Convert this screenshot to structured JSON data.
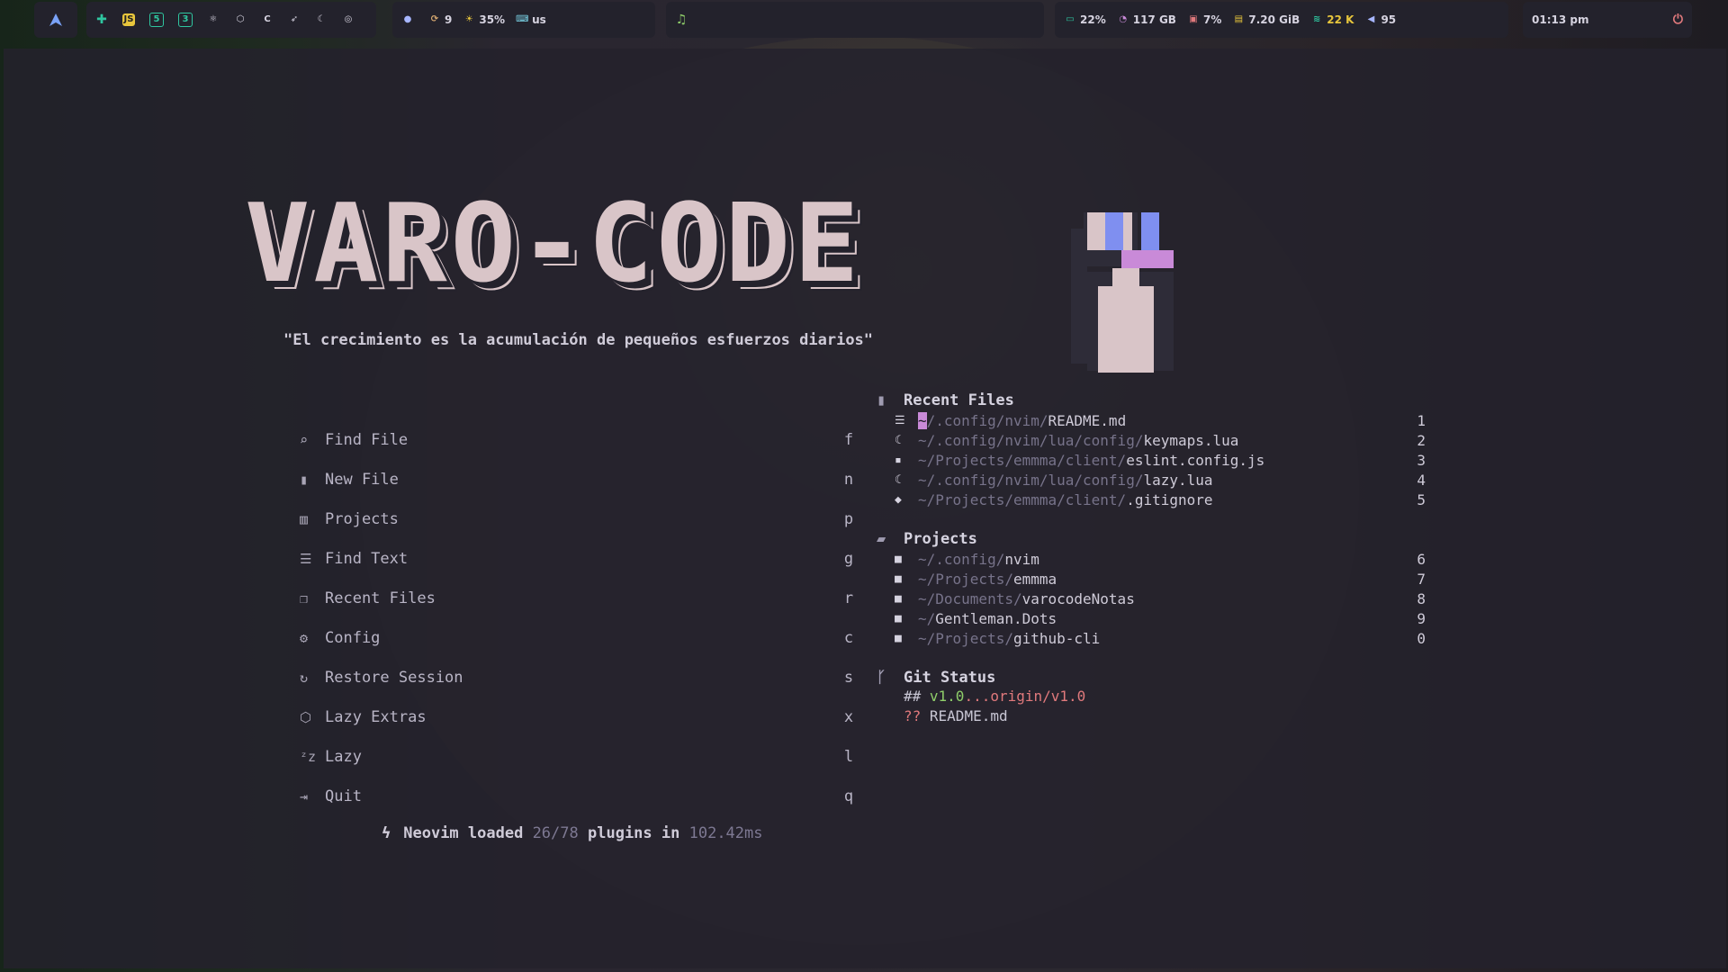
{
  "topbar": {
    "launcher_icon": "arch-icon",
    "workspace_icons": [
      "plus-icon",
      "js-icon",
      "html5-icon",
      "css3-icon",
      "react-icon",
      "nodejs-icon",
      "c-icon",
      "rocket-icon",
      "lua-icon",
      "github-icon"
    ],
    "indicators": {
      "updates": "9",
      "brightness": "35%",
      "keyboard": "us"
    },
    "music_icon": "music-note-icon",
    "stats": {
      "battery": "22%",
      "disk": "117 GB",
      "cpu": "7%",
      "ram": "7.20 GiB",
      "network": "22 K",
      "volume": "95"
    },
    "clock": "01:13 pm"
  },
  "dashboard": {
    "logo": "VARO-CODE",
    "tagline": "\"El crecimiento es la acumulación de pequeños esfuerzos diarios\"",
    "menu": [
      {
        "icon": "search-icon",
        "label": "Find File",
        "key": "f"
      },
      {
        "icon": "file-icon",
        "label": "New File",
        "key": "n"
      },
      {
        "icon": "projects-icon",
        "label": "Projects",
        "key": "p"
      },
      {
        "icon": "text-search-icon",
        "label": "Find Text",
        "key": "g"
      },
      {
        "icon": "copy-icon",
        "label": "Recent Files",
        "key": "r"
      },
      {
        "icon": "gear-icon",
        "label": "Config",
        "key": "c"
      },
      {
        "icon": "restore-icon",
        "label": "Restore Session",
        "key": "s"
      },
      {
        "icon": "box-icon",
        "label": "Lazy Extras",
        "key": "x"
      },
      {
        "icon": "sleep-icon",
        "label": "Lazy",
        "key": "l"
      },
      {
        "icon": "exit-icon",
        "label": "Quit",
        "key": "q"
      }
    ],
    "footer": {
      "prefix": "Neovim loaded",
      "plugins": "26/78",
      "middle": "plugins in",
      "time": "102.42ms"
    }
  },
  "recent_files": {
    "title": "Recent Files",
    "items": [
      {
        "dir": "~/.config/nvim/",
        "name": "README.md",
        "index": "1"
      },
      {
        "dir": "~/.config/nvim/lua/config/",
        "name": "keymaps.lua",
        "index": "2"
      },
      {
        "dir": "~/Projects/emmma/client/",
        "name": "eslint.config.js",
        "index": "3"
      },
      {
        "dir": "~/.config/nvim/lua/config/",
        "name": "lazy.lua",
        "index": "4"
      },
      {
        "dir": "~/Projects/emmma/client/",
        "name": ".gitignore",
        "index": "5"
      }
    ]
  },
  "projects": {
    "title": "Projects",
    "items": [
      {
        "dir": "~/.config/",
        "name": "nvim",
        "index": "6"
      },
      {
        "dir": "~/Projects/",
        "name": "emmma",
        "index": "7"
      },
      {
        "dir": "~/Documents/",
        "name": "varocodeNotas",
        "index": "8"
      },
      {
        "dir": "~/",
        "name": "Gentleman.Dots",
        "index": "9"
      },
      {
        "dir": "~/Projects/",
        "name": "github-cli",
        "index": "0"
      }
    ]
  },
  "git_status": {
    "title": "Git Status",
    "branch_prefix": "##",
    "branch_local": "v1.0",
    "branch_sep": "...",
    "branch_remote": "origin/v1.0",
    "untracked_prefix": "??",
    "untracked_file": "README.md"
  },
  "colors": {
    "accent": "#c98ad8",
    "logo": "#d9c5c8",
    "git_green": "#8fce6a",
    "git_red": "#e0797c"
  }
}
